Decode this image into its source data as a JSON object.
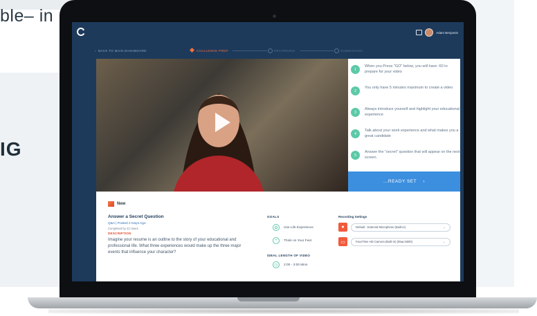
{
  "background_text": {
    "top_fragment": "ble– in",
    "left_fragment": "IG"
  },
  "app": {
    "user_name": "Adam Benjamin"
  },
  "progress": {
    "back_label": "BACK TO MAIN DASHBOARD",
    "steps": [
      {
        "label": "CHALLENGE PREP",
        "state": "active"
      },
      {
        "label": "RECORDING",
        "state": "inactive"
      },
      {
        "label": "SUBMISSION",
        "state": "inactive"
      }
    ]
  },
  "instructions": [
    {
      "num": "1",
      "text": "When you Press \"GO\" below, you will have :60 to prepare for your video"
    },
    {
      "num": "2",
      "text": "You only have 5 minutes maximum to create a video"
    },
    {
      "num": "3",
      "text": "Always introduce yourself and highlight your educational experience"
    },
    {
      "num": "4",
      "text": "Talk about your work experience and what makes you a great candidate"
    },
    {
      "num": "5",
      "text": "Answer the \"secret\" question that will appear on the next screen."
    }
  ],
  "ready_button": "...READY SET",
  "challenge": {
    "badge": "New",
    "title": "Answer a Secret Question",
    "meta": "Q&A | Posted 2 Days Ago",
    "completed": "Completed by 22 Users",
    "description_heading": "DESCRIPTION",
    "description": "Imagine your resume is an outline to the story of your educational and professional life. What three experiences would make up the three major events that influence your character?"
  },
  "goals": {
    "heading": "GOALS",
    "items": [
      "Use Life Experience",
      "Think on Your Feet"
    ],
    "ideal_heading": "IDEAL LENGTH OF VIDEO",
    "ideal_value": "2:00 - 3:00 Mins"
  },
  "recording": {
    "heading": "Recording Settings",
    "microphone": "Default - External Microphone (Built-in)",
    "camera": "FaceTime HD Camera (Built-in) (05ac:8600)"
  },
  "colors": {
    "accent_orange": "#f36f3c",
    "accent_blue": "#3c8fde",
    "accent_green": "#5cc9a7",
    "navy": "#1d3a5b"
  }
}
